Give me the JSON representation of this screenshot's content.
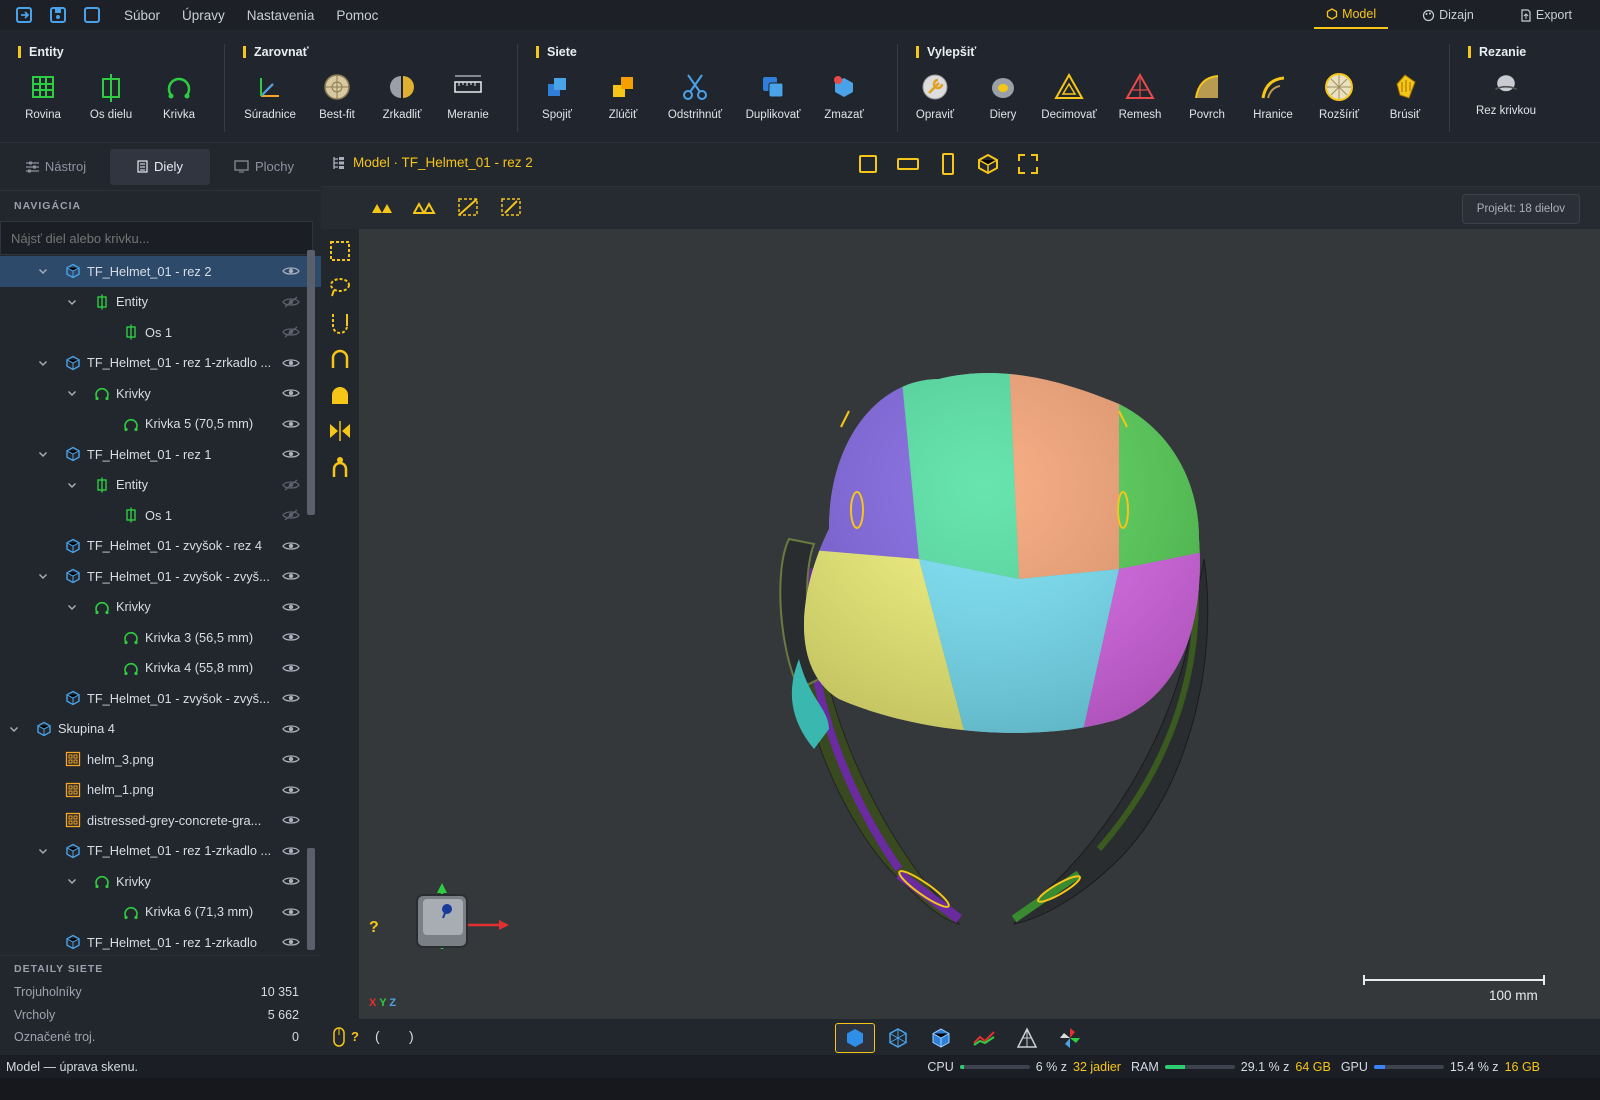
{
  "menubar": {
    "items": [
      "Súbor",
      "Úpravy",
      "Nastavenia",
      "Pomoc"
    ],
    "modes": [
      {
        "label": "Model",
        "icon": "cube-icon",
        "active": true
      },
      {
        "label": "Dizajn",
        "icon": "palette-icon",
        "active": false
      },
      {
        "label": "Export",
        "icon": "export-icon",
        "active": false
      }
    ]
  },
  "ribbon": {
    "groups": [
      {
        "title": "Entity",
        "tools": [
          "Rovina",
          "Os dielu",
          "Krivka"
        ]
      },
      {
        "title": "Zarovnať",
        "tools": [
          "Súradnice",
          "Best-fit",
          "Zrkadliť",
          "Meranie"
        ]
      },
      {
        "title": "Siete",
        "tools": [
          "Spojiť",
          "Zlúčiť",
          "Odstrihnúť",
          "Duplikovať",
          "Zmazať"
        ]
      },
      {
        "title": "Vylepšiť",
        "tools": [
          "Opraviť",
          "Diery",
          "Decimovať",
          "Remesh",
          "Povrch",
          "Hranice",
          "Rozšíriť",
          "Brúsiť"
        ]
      },
      {
        "title": "Rezanie",
        "tools": [
          "Rez krivkou"
        ]
      }
    ]
  },
  "sidebar": {
    "tabs": [
      {
        "label": "Nástroj",
        "active": false
      },
      {
        "label": "Diely",
        "active": true
      },
      {
        "label": "Plochy",
        "active": false
      }
    ],
    "nav_title": "NAVIGÁCIA",
    "search_placeholder": "Nájsť diel alebo krivku...",
    "tree": [
      {
        "label": "TF_Helmet_01 - rez 2",
        "depth": 1,
        "icon": "mesh",
        "expanded": true,
        "selected": true,
        "visible": true
      },
      {
        "label": "Entity",
        "depth": 2,
        "icon": "entity",
        "expanded": true,
        "visible": false
      },
      {
        "label": "Os 1",
        "depth": 3,
        "icon": "entity",
        "visible": false
      },
      {
        "label": "TF_Helmet_01 - rez 1-zrkadlo ...",
        "depth": 1,
        "icon": "mesh",
        "expanded": true,
        "visible": true
      },
      {
        "label": "Krivky",
        "depth": 2,
        "icon": "curve",
        "expanded": true,
        "visible": true
      },
      {
        "label": "Krivka 5  (70,5 mm)",
        "depth": 3,
        "icon": "curve",
        "visible": true
      },
      {
        "label": "TF_Helmet_01 - rez 1",
        "depth": 1,
        "icon": "mesh",
        "expanded": true,
        "visible": true
      },
      {
        "label": "Entity",
        "depth": 2,
        "icon": "entity",
        "expanded": true,
        "visible": false
      },
      {
        "label": "Os 1",
        "depth": 3,
        "icon": "entity",
        "visible": false
      },
      {
        "label": "TF_Helmet_01 - zvyšok - rez 4",
        "depth": 1,
        "icon": "mesh",
        "visible": true
      },
      {
        "label": "TF_Helmet_01 - zvyšok - zvyš...",
        "depth": 1,
        "icon": "mesh",
        "expanded": true,
        "visible": true
      },
      {
        "label": "Krivky",
        "depth": 2,
        "icon": "curve",
        "expanded": true,
        "visible": true
      },
      {
        "label": "Krivka 3  (56,5 mm)",
        "depth": 3,
        "icon": "curve",
        "visible": true
      },
      {
        "label": "Krivka 4  (55,8 mm)",
        "depth": 3,
        "icon": "curve",
        "visible": true
      },
      {
        "label": "TF_Helmet_01 - zvyšok - zvyš...",
        "depth": 1,
        "icon": "mesh",
        "visible": true
      },
      {
        "label": "Skupina 4",
        "depth": 0,
        "icon": "mesh",
        "expanded": true,
        "visible": true
      },
      {
        "label": "helm_3.png",
        "depth": 1,
        "icon": "image",
        "visible": true
      },
      {
        "label": "helm_1.png",
        "depth": 1,
        "icon": "image",
        "visible": true
      },
      {
        "label": "distressed-grey-concrete-gra...",
        "depth": 1,
        "icon": "image",
        "visible": true
      },
      {
        "label": "TF_Helmet_01 - rez 1-zrkadlo ...",
        "depth": 1,
        "icon": "mesh",
        "expanded": true,
        "visible": true
      },
      {
        "label": "Krivky",
        "depth": 2,
        "icon": "curve",
        "expanded": true,
        "visible": true
      },
      {
        "label": "Krivka 6  (71,3 mm)",
        "depth": 3,
        "icon": "curve",
        "visible": true
      },
      {
        "label": "TF_Helmet_01 - rez 1-zrkadlo",
        "depth": 1,
        "icon": "mesh",
        "visible": true
      }
    ],
    "details_title": "DETAILY SIETE",
    "details": [
      {
        "label": "Trojuholníky",
        "value": "10 351"
      },
      {
        "label": "Vrcholy",
        "value": "5 662"
      },
      {
        "label": "Označené troj.",
        "value": "0"
      }
    ]
  },
  "viewport": {
    "title": "Model · TF_Helmet_01 - rez 2",
    "project_badge": "Projekt: 18 dielov",
    "axes_label": [
      "X",
      "Y",
      "Z"
    ],
    "scale_label": "100 mm",
    "help_mark": "?",
    "bottom_mouse_help": "?",
    "bottom_paren_left": "(",
    "bottom_paren_right": ")"
  },
  "status": {
    "message": "Model — úprava skenu.",
    "cpu_label": "CPU",
    "cpu_text": "6 % z",
    "cpu_cores": "32 jadier",
    "cpu_fraction": 0.06,
    "ram_label": "RAM",
    "ram_text": "29.1 % z",
    "ram_total": "64 GB",
    "ram_fraction": 0.291,
    "gpu_label": "GPU",
    "gpu_text": "15.4 % z",
    "gpu_total": "16 GB",
    "gpu_fraction": 0.154
  },
  "colors": {
    "accent": "#f5c518",
    "selection": "#2d4a6b",
    "mesh_icon": "#4aa3e8",
    "curve_icon": "#2ecc40",
    "cpu_bar": "#2ecc71",
    "ram_bar": "#2ecc71",
    "gpu_bar": "#3b82f6"
  }
}
